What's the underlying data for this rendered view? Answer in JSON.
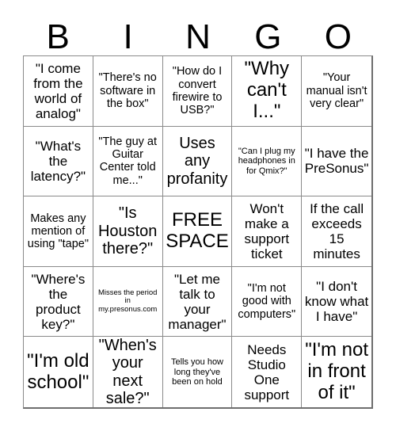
{
  "card": {
    "title": "BINGO",
    "header_letters": [
      "B",
      "I",
      "N",
      "G",
      "O"
    ],
    "free_space_label": "FREE SPACE",
    "columns": 5,
    "rows": 5,
    "colors": {
      "background": "#ffffff",
      "text": "#000000",
      "grid_line": "#8a8a8a",
      "grid_outer": "#6e6e6e"
    },
    "cells": [
      {
        "id": "b1",
        "column": "B",
        "row": 1,
        "text": "\"I come from the world of analog\"",
        "size": "md"
      },
      {
        "id": "i1",
        "column": "I",
        "row": 1,
        "text": "\"There's no software in the box\"",
        "size": "sm"
      },
      {
        "id": "n1",
        "column": "N",
        "row": 1,
        "text": "\"How do I convert firewire to USB?\"",
        "size": "sm"
      },
      {
        "id": "g1",
        "column": "G",
        "row": 1,
        "text": "\"Why can't I...\"",
        "size": "xl"
      },
      {
        "id": "o1",
        "column": "O",
        "row": 1,
        "text": "\"Your manual isn't very clear\"",
        "size": "sm"
      },
      {
        "id": "b2",
        "column": "B",
        "row": 2,
        "text": "\"What's the latency?\"",
        "size": "md"
      },
      {
        "id": "i2",
        "column": "I",
        "row": 2,
        "text": "\"The guy at Guitar Center told me...\"",
        "size": "sm"
      },
      {
        "id": "n2",
        "column": "N",
        "row": 2,
        "text": "Uses any profanity",
        "size": "lg"
      },
      {
        "id": "g2",
        "column": "G",
        "row": 2,
        "text": "\"Can I plug my headphones in for Qmix?\"",
        "size": "xs"
      },
      {
        "id": "o2",
        "column": "O",
        "row": 2,
        "text": "\"I have the PreSonus\"",
        "size": "md"
      },
      {
        "id": "b3",
        "column": "B",
        "row": 3,
        "text": "Makes any mention of using \"tape\"",
        "size": "sm"
      },
      {
        "id": "i3",
        "column": "I",
        "row": 3,
        "text": "\"Is Houston there?\"",
        "size": "lg"
      },
      {
        "id": "n3",
        "column": "N",
        "row": 3,
        "text": "FREE SPACE",
        "size": "xl"
      },
      {
        "id": "g3",
        "column": "G",
        "row": 3,
        "text": "Won't make a support ticket",
        "size": "md"
      },
      {
        "id": "o3",
        "column": "O",
        "row": 3,
        "text": "If the call exceeds 15 minutes",
        "size": "md"
      },
      {
        "id": "b4",
        "column": "B",
        "row": 4,
        "text": "\"Where's the product key?\"",
        "size": "md"
      },
      {
        "id": "i4",
        "column": "I",
        "row": 4,
        "text": "Misses the period in my.presonus.com",
        "size": "xxs"
      },
      {
        "id": "n4",
        "column": "N",
        "row": 4,
        "text": "\"Let me talk to your manager\"",
        "size": "md"
      },
      {
        "id": "g4",
        "column": "G",
        "row": 4,
        "text": "\"I'm not good with computers\"",
        "size": "sm"
      },
      {
        "id": "o4",
        "column": "O",
        "row": 4,
        "text": "\"I don't know what I have\"",
        "size": "md"
      },
      {
        "id": "b5",
        "column": "B",
        "row": 5,
        "text": "\"I'm old school\"",
        "size": "xl"
      },
      {
        "id": "i5",
        "column": "I",
        "row": 5,
        "text": "\"When's your next sale?\"",
        "size": "lg"
      },
      {
        "id": "n5",
        "column": "N",
        "row": 5,
        "text": "Tells you how long they've been on hold",
        "size": "xs"
      },
      {
        "id": "g5",
        "column": "G",
        "row": 5,
        "text": "Needs Studio One support",
        "size": "md"
      },
      {
        "id": "o5",
        "column": "O",
        "row": 5,
        "text": "\"I'm not in front of it\"",
        "size": "xl"
      }
    ]
  }
}
